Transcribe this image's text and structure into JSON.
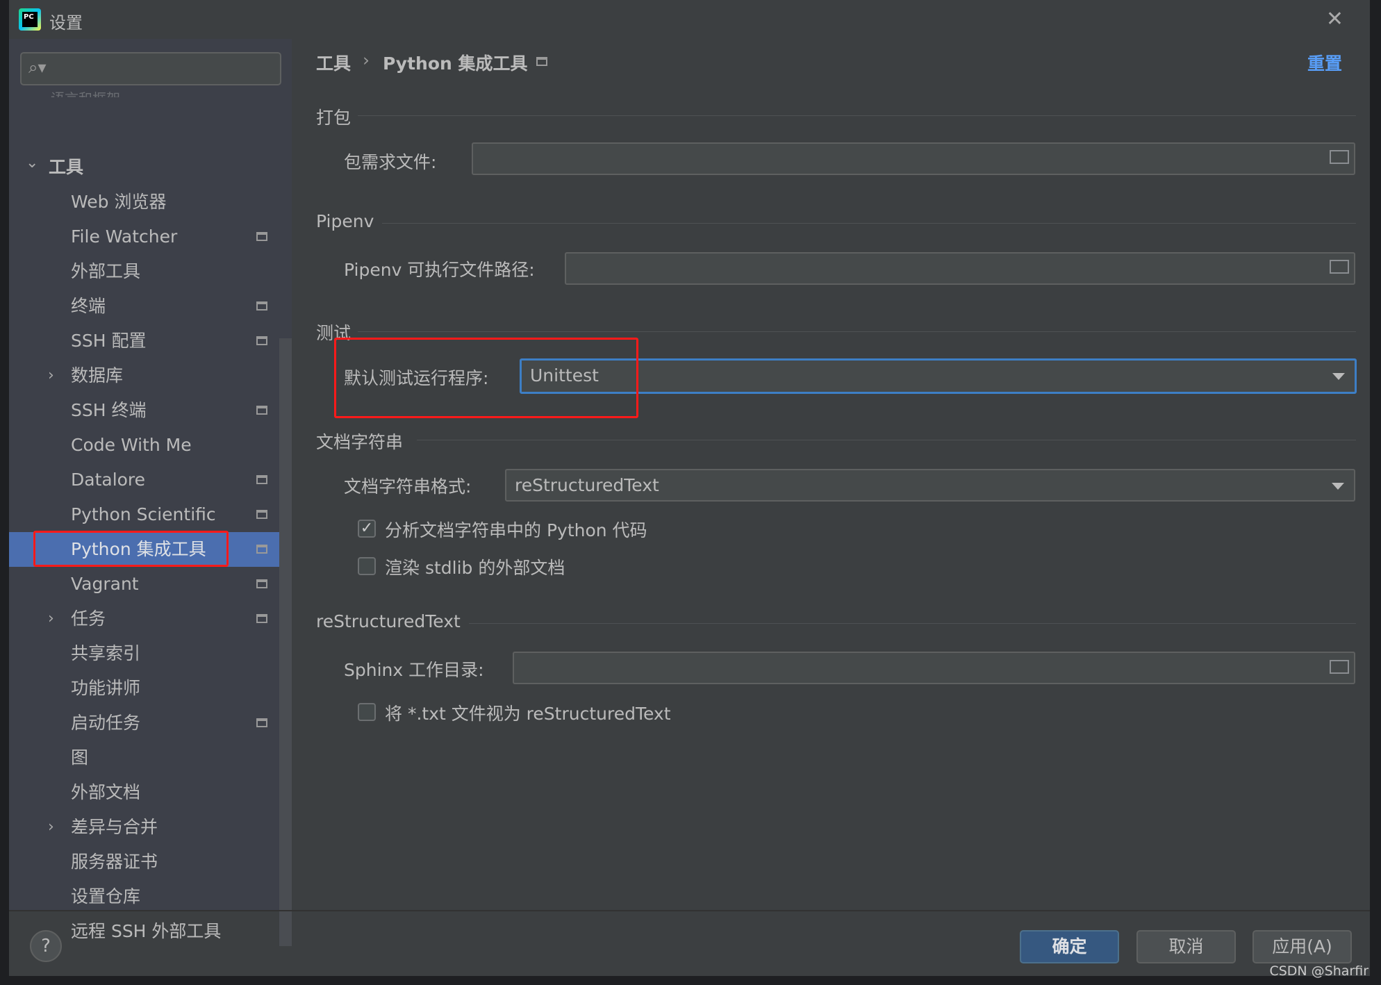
{
  "window": {
    "title": "设置",
    "close_icon": "close-icon"
  },
  "sidebar": {
    "search_placeholder": "",
    "ghost_text": "语言和框架",
    "items": [
      {
        "label": "工具",
        "expanded": true,
        "level": 0
      },
      {
        "label": "Web 浏览器",
        "pin": false
      },
      {
        "label": "File Watcher",
        "pin": true
      },
      {
        "label": "外部工具",
        "pin": false
      },
      {
        "label": "终端",
        "pin": true
      },
      {
        "label": "SSH 配置",
        "pin": true
      },
      {
        "label": "数据库",
        "pin": false,
        "expandable": true
      },
      {
        "label": "SSH 终端",
        "pin": true
      },
      {
        "label": "Code With Me",
        "pin": false
      },
      {
        "label": "Datalore",
        "pin": true
      },
      {
        "label": "Python Scientific",
        "pin": true
      },
      {
        "label": "Python 集成工具",
        "pin": true,
        "selected": true
      },
      {
        "label": "Vagrant",
        "pin": true
      },
      {
        "label": "任务",
        "pin": true,
        "expandable": true
      },
      {
        "label": "共享索引",
        "pin": false
      },
      {
        "label": "功能讲师",
        "pin": false
      },
      {
        "label": "启动任务",
        "pin": true
      },
      {
        "label": "图",
        "pin": false
      },
      {
        "label": "外部文档",
        "pin": false
      },
      {
        "label": "差异与合并",
        "pin": false,
        "expandable": true
      },
      {
        "label": "服务器证书",
        "pin": false
      },
      {
        "label": "设置仓库",
        "pin": false
      },
      {
        "label": "远程 SSH 外部工具",
        "pin": false
      }
    ]
  },
  "main": {
    "breadcrumb": [
      "工具",
      "Python 集成工具"
    ],
    "reset_label": "重置",
    "packaging": {
      "title": "打包",
      "req_label": "包需求文件:",
      "req_value": ""
    },
    "pipenv": {
      "title": "Pipenv",
      "path_label": "Pipenv 可执行文件路径:",
      "path_value": ""
    },
    "testing": {
      "title": "测试",
      "runner_label": "默认测试运行程序:",
      "runner_value": "Unittest"
    },
    "docstrings": {
      "title": "文档字符串",
      "format_label": "文档字符串格式:",
      "format_value": "reStructuredText",
      "analyze_label": "分析文档字符串中的 Python 代码",
      "analyze_checked": true,
      "render_label": "渲染 stdlib 的外部文档",
      "render_checked": false
    },
    "rst": {
      "title": "reStructuredText",
      "sphinx_label": "Sphinx 工作目录:",
      "sphinx_value": "",
      "txt_label": "将 *.txt 文件视为 reStructuredText",
      "txt_checked": false
    }
  },
  "buttons": {
    "ok": "确定",
    "cancel": "取消",
    "apply": "应用(A)",
    "help": "?"
  },
  "watermark": "CSDN @Sharfir",
  "colors": {
    "selection": "#4b6eaf",
    "primary_button": "#365880",
    "highlight_box": "#ff1a1a",
    "link": "#589df6"
  }
}
